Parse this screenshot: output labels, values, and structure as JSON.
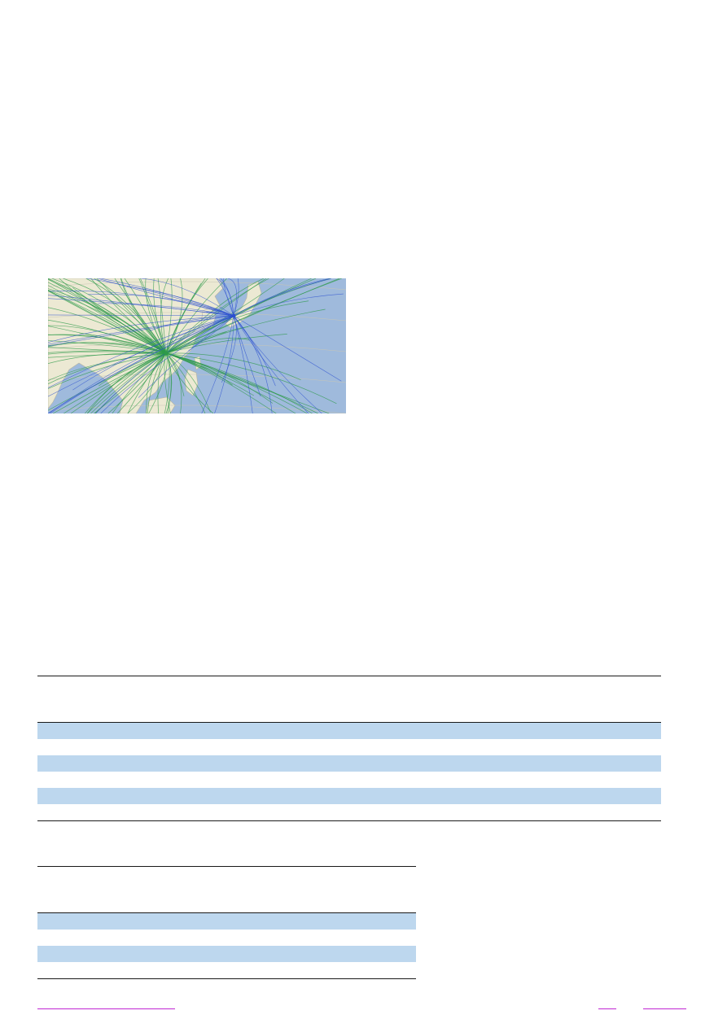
{
  "figure": {
    "type": "route-map",
    "hubs": [
      "green-hub",
      "blue-hub"
    ],
    "colors": {
      "land": "#ece9d3",
      "sea": "#9fbadc",
      "green_routes": "#2e9a4a",
      "blue_routes": "#2b4fd0",
      "grid": "#c9c6b4"
    }
  },
  "tables": [
    {
      "id": "table-1",
      "rows": 6,
      "shaded_rows": [
        0,
        2,
        4
      ],
      "shade_color": "#bdd7ee"
    },
    {
      "id": "table-2",
      "rows": 4,
      "shaded_rows": [
        0,
        2
      ],
      "shade_color": "#bdd7ee"
    }
  ],
  "footer": {
    "link_color": "#c026d3"
  }
}
